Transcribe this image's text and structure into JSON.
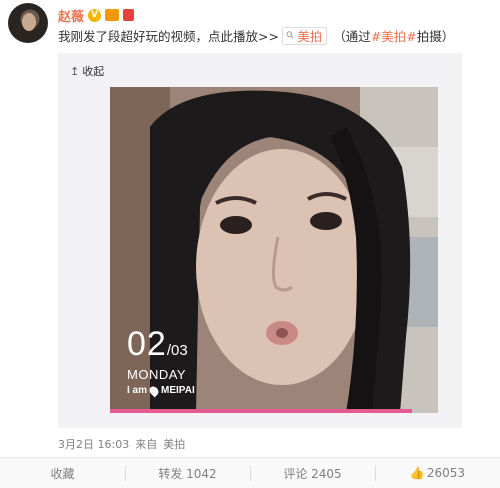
{
  "user": {
    "name": "赵薇",
    "verified_badge": "V"
  },
  "post": {
    "text": "我刚发了段超好玩的视频，点此播放>>",
    "link_label": "美拍",
    "meta_open": "（通过",
    "topic": "#美拍#",
    "meta_close": "拍摄）"
  },
  "media": {
    "collapse_label": "收起",
    "overlay": {
      "date_day": "02",
      "date_month": "/03",
      "weekday": "MONDAY",
      "brand_prefix": "I am",
      "brand_name": "MEIPAI"
    },
    "progress_fraction": 0.92,
    "progress_color": "#e45b93"
  },
  "footer": {
    "timestamp": "3月2日 16:03",
    "source_prefix": "来自",
    "source": "美拍"
  },
  "actions": {
    "favorite": "收藏",
    "repost": "转发 1042",
    "comment": "评论 2405",
    "like": "26053"
  },
  "colors": {
    "accent": "#eb7350",
    "action_text": "#808080"
  }
}
